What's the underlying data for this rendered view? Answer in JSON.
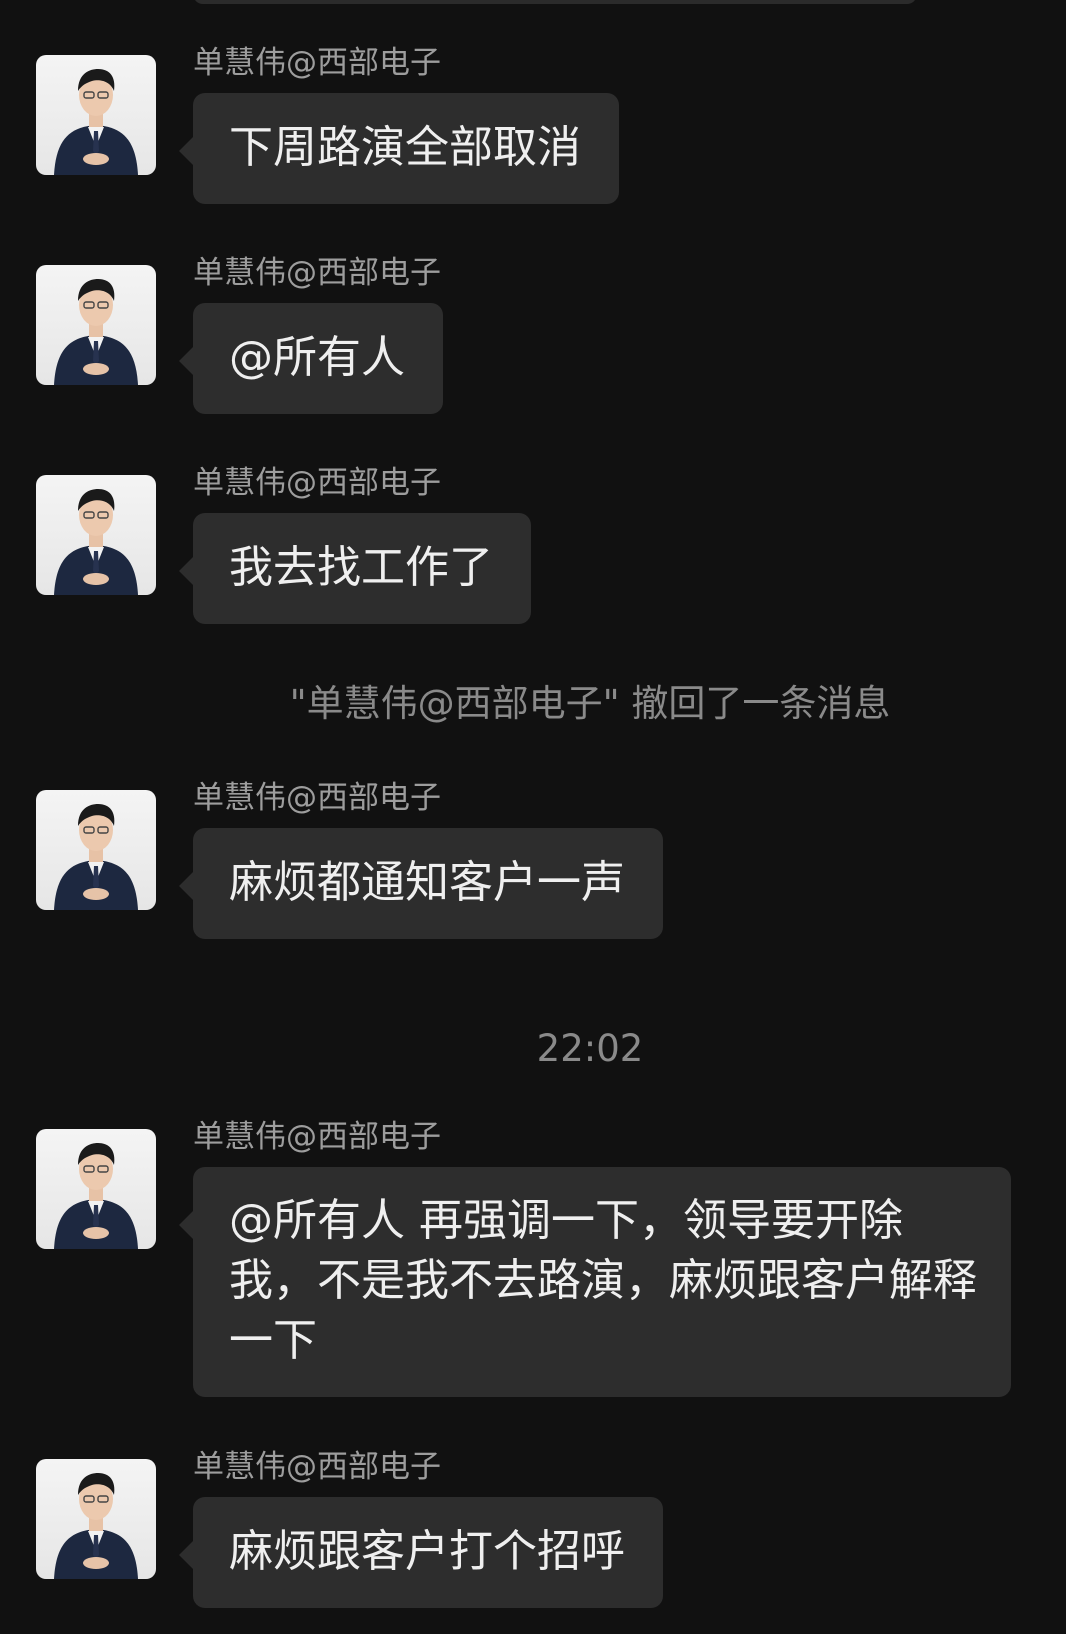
{
  "colors": {
    "background": "#111111",
    "bubble": "#2d2d2d",
    "sender_name": "#9d9d9d",
    "system_text": "#8a8a8a",
    "message_text": "#efefef"
  },
  "messages": [
    {
      "sender": "单慧伟@西部电子",
      "avatar_icon": "profile-photo-icon",
      "text": "下周路演全部取消"
    },
    {
      "sender": "单慧伟@西部电子",
      "avatar_icon": "profile-photo-icon",
      "text": "@所有人"
    },
    {
      "sender": "单慧伟@西部电子",
      "avatar_icon": "profile-photo-icon",
      "text": "我去找工作了"
    },
    {
      "sender": "单慧伟@西部电子",
      "avatar_icon": "profile-photo-icon",
      "text": "麻烦都通知客户一声"
    },
    {
      "sender": "单慧伟@西部电子",
      "avatar_icon": "profile-photo-icon",
      "text": "@所有人 再强调一下，领导要开除我，不是我不去路演，麻烦跟客户解释一下"
    },
    {
      "sender": "单慧伟@西部电子",
      "avatar_icon": "profile-photo-icon",
      "text": "麻烦跟客户打个招呼"
    }
  ],
  "system_note": "\"单慧伟@西部电子\" 撤回了一条消息",
  "timestamp": "22:02"
}
